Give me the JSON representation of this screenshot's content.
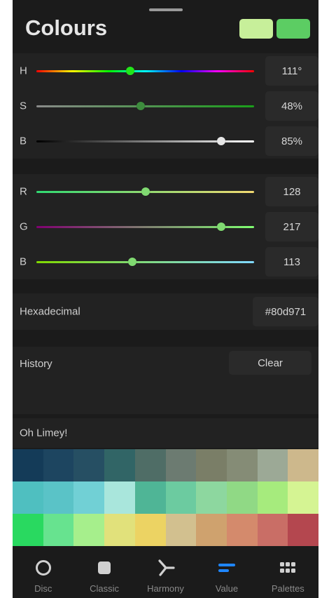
{
  "title": "Colours",
  "swatches": {
    "current": "#c7ef9a",
    "previous": "#5ccd63"
  },
  "hsb": [
    {
      "label": "H",
      "value": "111°",
      "fraction": 0.43,
      "gradient": "linear-gradient(to right,#ff0000,#ffff00,#00ff00,#00ffff,#0000ff,#ff00ff,#ff0000)",
      "thumb": "#22e51b"
    },
    {
      "label": "S",
      "value": "48%",
      "fraction": 0.48,
      "gradient": "linear-gradient(to right,#8a8a8a,#1a9e1a)",
      "thumb": "#3d8c3d"
    },
    {
      "label": "B",
      "value": "85%",
      "fraction": 0.85,
      "gradient": "linear-gradient(to right,#000000,#ffffff)",
      "thumb": "#e6e6e6"
    }
  ],
  "rgb": [
    {
      "label": "R",
      "value": "128",
      "fraction": 0.5,
      "gradient": "linear-gradient(to right,#30d971,#f2d971)",
      "thumb": "#80d971"
    },
    {
      "label": "G",
      "value": "217",
      "fraction": 0.85,
      "gradient": "linear-gradient(to right,#800071,#80ff71)",
      "thumb": "#80d971"
    },
    {
      "label": "B",
      "value": "113",
      "fraction": 0.44,
      "gradient": "linear-gradient(to right,#80d900,#80d9ff)",
      "thumb": "#80d971"
    }
  ],
  "hex": {
    "label": "Hexadecimal",
    "value": "#80d971"
  },
  "history": {
    "label": "History",
    "clear_label": "Clear"
  },
  "palette": {
    "name": "Oh Limey!",
    "rows": [
      [
        "#143b58",
        "#1d4560",
        "#264f63",
        "#316566",
        "#4f6d66",
        "#6c7b71",
        "#7a7e67",
        "#858c76",
        "#9ca996",
        "#cdb88c"
      ],
      [
        "#4fbfc0",
        "#5ac3c7",
        "#71d0d5",
        "#a9e6dc",
        "#4fb596",
        "#6ccba0",
        "#8dd79f",
        "#90d985",
        "#a6eb7d",
        "#d5f493"
      ],
      [
        "#29d960",
        "#67e38f",
        "#a6ef8c",
        "#e1e17b",
        "#ecd363",
        "#d2c08f",
        "#cfa26e",
        "#d48a6c",
        "#c96e66",
        "#b4474f"
      ]
    ]
  },
  "tabs": [
    {
      "label": "Disc",
      "icon": "disc-icon"
    },
    {
      "label": "Classic",
      "icon": "classic-icon"
    },
    {
      "label": "Harmony",
      "icon": "harmony-icon"
    },
    {
      "label": "Value",
      "icon": "value-icon"
    },
    {
      "label": "Palettes",
      "icon": "palettes-icon"
    }
  ],
  "accent": "#1f86ff"
}
